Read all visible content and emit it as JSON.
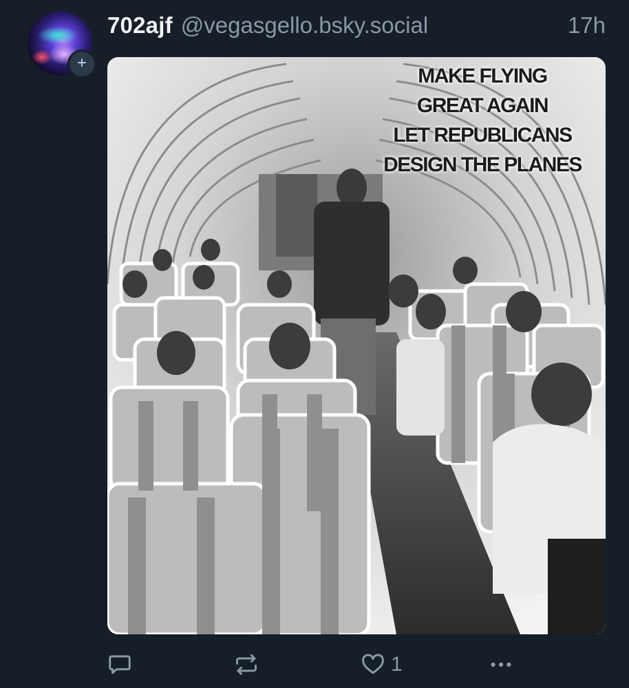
{
  "post": {
    "display_name": "702ajf",
    "handle": "@vegasgello.bsky.social",
    "timestamp": "17h"
  },
  "avatar": {
    "follow_symbol": "+"
  },
  "image": {
    "caption_lines": [
      "MAKE FLYING",
      "GREAT AGAIN",
      "LET REPUBLICANS",
      "DESIGN THE PLANES"
    ]
  },
  "actions": {
    "reply_icon": "speech-bubble-icon",
    "repost_icon": "repost-arrows-icon",
    "like_icon": "heart-icon",
    "like_count": "1",
    "more_icon": "ellipsis-icon"
  },
  "colors": {
    "background": "#161e27",
    "primary_text": "#f1f3f5",
    "secondary_text": "#8a98a8"
  }
}
